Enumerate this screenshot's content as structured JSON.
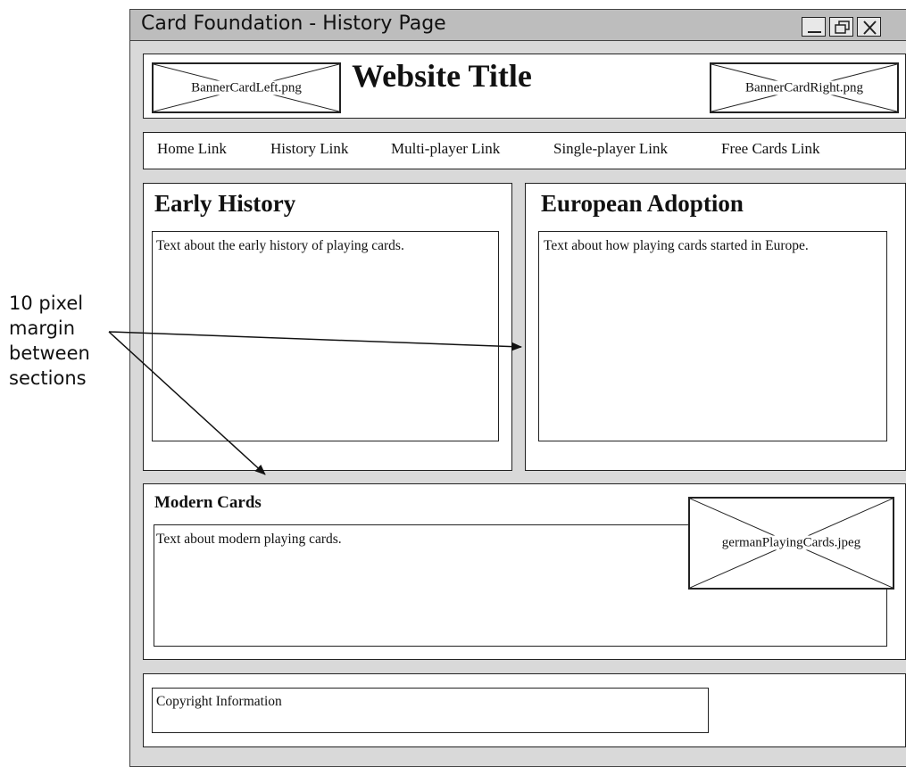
{
  "window": {
    "title": "Card Foundation - History Page"
  },
  "header": {
    "site_title": "Website Title",
    "banner_left": "BannerCardLeft.png",
    "banner_right": "BannerCardRight.png"
  },
  "nav": {
    "links": [
      "Home Link",
      "History Link",
      "Multi-player Link",
      "Single-player Link",
      "Free Cards Link"
    ]
  },
  "sections": {
    "early": {
      "heading": "Early History",
      "text": "Text about the early history of playing cards."
    },
    "european": {
      "heading": "European Adoption",
      "text": "Text about how playing cards started in Europe."
    },
    "modern": {
      "heading": "Modern Cards",
      "text": "Text about modern playing cards.",
      "image": "germanPlayingCards.jpeg"
    }
  },
  "footer": {
    "copyright": "Copyright Information"
  },
  "annotation": {
    "lines": [
      "10 pixel",
      "margin",
      "between",
      "sections"
    ]
  }
}
